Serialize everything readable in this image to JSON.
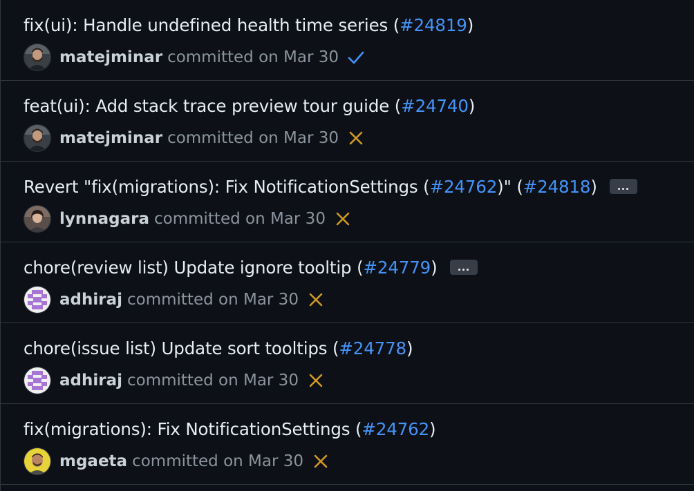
{
  "commits": [
    {
      "message": "fix(ui): Handle undefined health time series (",
      "pr": "#24819",
      "suffix": ")",
      "author": "matejminar",
      "committed": "committed on Mar 30",
      "status": "success",
      "avatar": "photo-man"
    },
    {
      "message": "feat(ui): Add stack trace preview tour guide (",
      "pr": "#24740",
      "suffix": ")",
      "author": "matejminar",
      "committed": "committed on Mar 30",
      "status": "failure",
      "avatar": "photo-man"
    },
    {
      "message": "Revert \"fix(migrations): Fix NotificationSettings (",
      "pr": "#24762",
      "middle": ")\" (",
      "pr2": "#24818",
      "suffix": ")",
      "author": "lynnagara",
      "committed": "committed on Mar 30",
      "status": "failure",
      "avatar": "photo-woman",
      "has_more": true
    },
    {
      "message": "chore(review list) Update ignore tooltip (",
      "pr": "#24779",
      "suffix": ")",
      "author": "adhiraj",
      "committed": "committed on Mar 30",
      "status": "failure",
      "avatar": "identicon",
      "has_more": true
    },
    {
      "message": "chore(issue list) Update sort tooltips (",
      "pr": "#24778",
      "suffix": ")",
      "author": "adhiraj",
      "committed": "committed on Mar 30",
      "status": "failure",
      "avatar": "identicon"
    },
    {
      "message": "fix(migrations): Fix NotificationSettings (",
      "pr": "#24762",
      "suffix": ")",
      "author": "mgaeta",
      "committed": "committed on Mar 30",
      "status": "failure",
      "avatar": "photo-yellow"
    }
  ],
  "colors": {
    "background": "#0d1117",
    "link": "#4493f8",
    "success": "#4493f8",
    "failure": "#d29922",
    "border": "#30363d",
    "muted": "#8b949e"
  }
}
